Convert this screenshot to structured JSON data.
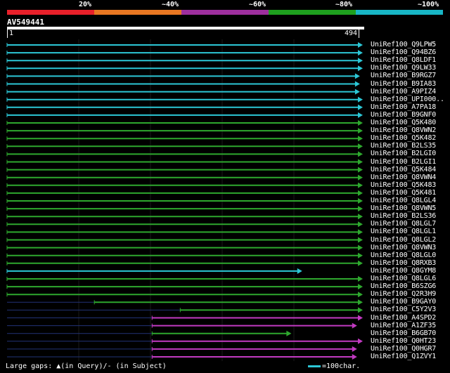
{
  "legend": {
    "labels": [
      "20%",
      "~40%",
      "~60%",
      "~80%",
      "~100%"
    ],
    "colors": [
      "#e8202a",
      "#e87722",
      "#9e2f9e",
      "#1ea01e",
      "#18b6c6"
    ]
  },
  "query": {
    "id": "AV549441",
    "start": "1",
    "end": "494",
    "length": 494
  },
  "colors": {
    "cyan": "#2cc7d6",
    "green": "#2ea82e",
    "magenta": "#c23ac2",
    "gap": "#223377"
  },
  "hits": [
    {
      "label": "UniRef100_Q9LPW5",
      "color": "cyan",
      "start": 1,
      "end": 494
    },
    {
      "label": "UniRef100_Q94BZ6",
      "color": "cyan",
      "start": 1,
      "end": 494
    },
    {
      "label": "UniRef100_Q8LDF1",
      "color": "cyan",
      "start": 1,
      "end": 494
    },
    {
      "label": "UniRef100_Q9LW33",
      "color": "cyan",
      "start": 1,
      "end": 494
    },
    {
      "label": "UniRef100_B9RGZ7",
      "color": "cyan",
      "start": 1,
      "end": 490
    },
    {
      "label": "UniRef100_B9IA83",
      "color": "cyan",
      "start": 1,
      "end": 490
    },
    {
      "label": "UniRef100_A9PIZ4",
      "color": "cyan",
      "start": 1,
      "end": 490
    },
    {
      "label": "UniRef100_UPI000..",
      "color": "cyan",
      "start": 1,
      "end": 494
    },
    {
      "label": "UniRef100_A7PA18",
      "color": "cyan",
      "start": 1,
      "end": 494
    },
    {
      "label": "UniRef100_B9GNF0",
      "color": "cyan",
      "start": 1,
      "end": 494
    },
    {
      "label": "UniRef100_Q5K480",
      "color": "green",
      "start": 1,
      "end": 494
    },
    {
      "label": "UniRef100_Q8VWN2",
      "color": "green",
      "start": 1,
      "end": 494
    },
    {
      "label": "UniRef100_Q5K482",
      "color": "green",
      "start": 1,
      "end": 494
    },
    {
      "label": "UniRef100_B2LS35",
      "color": "green",
      "start": 1,
      "end": 494
    },
    {
      "label": "UniRef100_B2LGI0",
      "color": "green",
      "start": 1,
      "end": 494
    },
    {
      "label": "UniRef100_B2LGI1",
      "color": "green",
      "start": 1,
      "end": 494
    },
    {
      "label": "UniRef100_Q5K484",
      "color": "green",
      "start": 1,
      "end": 494
    },
    {
      "label": "UniRef100_Q8VWN4",
      "color": "green",
      "start": 1,
      "end": 494
    },
    {
      "label": "UniRef100_Q5K483",
      "color": "green",
      "start": 1,
      "end": 494
    },
    {
      "label": "UniRef100_Q5K481",
      "color": "green",
      "start": 1,
      "end": 494
    },
    {
      "label": "UniRef100_Q8LGL4",
      "color": "green",
      "start": 1,
      "end": 494
    },
    {
      "label": "UniRef100_Q8VWN5",
      "color": "green",
      "start": 1,
      "end": 494
    },
    {
      "label": "UniRef100_B2LS36",
      "color": "green",
      "start": 1,
      "end": 494
    },
    {
      "label": "UniRef100_Q8LGL7",
      "color": "green",
      "start": 1,
      "end": 494
    },
    {
      "label": "UniRef100_Q8LGL1",
      "color": "green",
      "start": 1,
      "end": 494
    },
    {
      "label": "UniRef100_Q8LGL2",
      "color": "green",
      "start": 1,
      "end": 494
    },
    {
      "label": "UniRef100_Q8VWN3",
      "color": "green",
      "start": 1,
      "end": 494
    },
    {
      "label": "UniRef100_Q8LGL0",
      "color": "green",
      "start": 1,
      "end": 494
    },
    {
      "label": "UniRef100_Q8RXB3",
      "color": "green",
      "start": 1,
      "end": 494
    },
    {
      "label": "UniRef100_Q8GYM8",
      "color": "cyan",
      "start": 1,
      "end": 410
    },
    {
      "label": "UniRef100_Q8LGL6",
      "color": "green",
      "start": 1,
      "end": 494
    },
    {
      "label": "UniRef100_B6SZG6",
      "color": "green",
      "start": 1,
      "end": 494
    },
    {
      "label": "UniRef100_Q2R3H9",
      "color": "green",
      "start": 1,
      "end": 494
    },
    {
      "label": "UniRef100_B9GAY0",
      "color": "green",
      "start": 122,
      "end": 494
    },
    {
      "label": "UniRef100_C5Y2V3",
      "color": "green",
      "start": 241,
      "end": 494
    },
    {
      "label": "UniRef100_A4SPD2",
      "color": "magenta",
      "start": 202,
      "end": 494
    },
    {
      "label": "UniRef100_A1ZF35",
      "color": "magenta",
      "start": 202,
      "end": 486
    },
    {
      "label": "UniRef100_B6GB70",
      "color": "green",
      "start": 202,
      "end": 395
    },
    {
      "label": "UniRef100_Q0HT23",
      "color": "magenta",
      "start": 202,
      "end": 494
    },
    {
      "label": "UniRef100_Q0HGR7",
      "color": "magenta",
      "start": 202,
      "end": 486
    },
    {
      "label": "UniRef100_Q1ZVY1",
      "color": "magenta",
      "start": 202,
      "end": 486
    }
  ],
  "footer": {
    "gaps_text": "Large gaps: ▲(in Query)/- (in Subject)",
    "scale_text": "=100char."
  }
}
